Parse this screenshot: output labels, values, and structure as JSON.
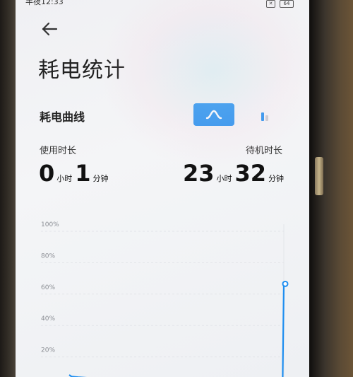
{
  "status_bar": {
    "time": "半夜12:33",
    "battery": "64"
  },
  "page": {
    "title": "耗电统计"
  },
  "section": {
    "title": "耗电曲线",
    "toggle_curve_icon": "curve-icon",
    "toggle_bar_icon": "bar-chart-icon"
  },
  "usage": {
    "label": "使用时长",
    "hours": "0",
    "hours_unit": "小时",
    "minutes": "1",
    "minutes_unit": "分钟"
  },
  "standby": {
    "label": "待机时长",
    "hours": "23",
    "hours_unit": "小时",
    "minutes": "32",
    "minutes_unit": "分钟"
  },
  "colors": {
    "accent": "#1e8ef0",
    "line": "#1e8ef0"
  },
  "chart_data": {
    "type": "line",
    "title": "",
    "xlabel": "",
    "ylabel": "",
    "ylim": [
      0,
      100
    ],
    "y_ticks": [
      "100%",
      "80%",
      "60%",
      "40%",
      "20%"
    ],
    "y_tick_values": [
      100,
      80,
      60,
      40,
      20
    ],
    "grid": true,
    "series": [
      {
        "x": [
          0,
          0.03,
          0.06,
          0.1,
          0.3,
          0.6,
          0.9,
          0.995,
          1.0
        ],
        "values": [
          4,
          3,
          2.6,
          2.2,
          2,
          2,
          2,
          2,
          62
        ]
      }
    ]
  }
}
